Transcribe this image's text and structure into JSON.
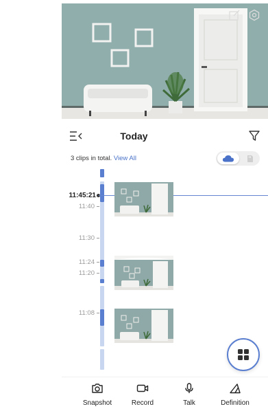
{
  "header": {
    "title": "Today"
  },
  "summary": {
    "text": "3 clips in total.",
    "link": "View All"
  },
  "storage": {
    "selected": "cloud",
    "options": [
      "cloud-icon",
      "sd-card-icon"
    ]
  },
  "timeline": {
    "current_time": "11:45:21",
    "labels": [
      "11:40",
      "11:30",
      "11:24",
      "11:20",
      "11:08"
    ]
  },
  "toolbar": {
    "actions": [
      {
        "label": "Snapshot",
        "icon": "camera-icon"
      },
      {
        "label": "Record",
        "icon": "video-camera-icon"
      },
      {
        "label": "Talk",
        "icon": "microphone-icon"
      },
      {
        "label": "Definition",
        "icon": "definition-icon"
      }
    ]
  },
  "colors": {
    "accent": "#5b7fd0",
    "link": "#4a72c9",
    "timeline_light": "#c9d6ef"
  }
}
